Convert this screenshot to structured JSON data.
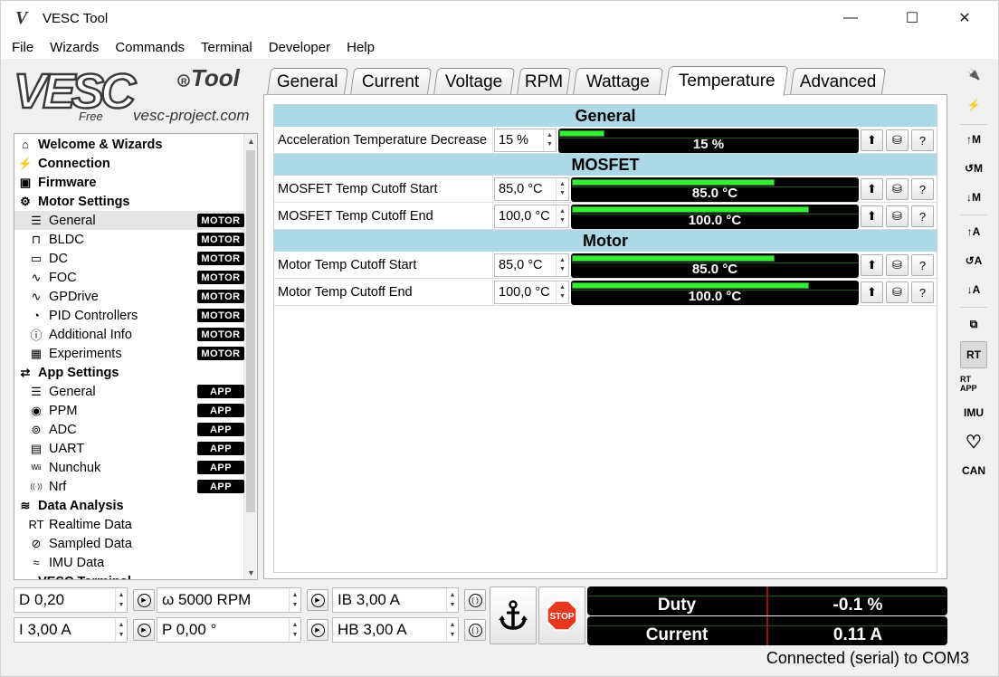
{
  "window": {
    "title": "VESC Tool",
    "minimize": "—",
    "maximize": "☐",
    "close": "✕"
  },
  "menu": [
    "File",
    "Wizards",
    "Commands",
    "Terminal",
    "Developer",
    "Help"
  ],
  "logo": {
    "main": "VESC",
    "tool": "Tool",
    "free": "Free",
    "url": "vesc-project.com"
  },
  "tree": [
    {
      "label": "Welcome & Wizards",
      "level": 0,
      "icon": "home-icon",
      "glyph": "⌂"
    },
    {
      "label": "Connection",
      "level": 0,
      "icon": "plug-icon",
      "glyph": "⚡"
    },
    {
      "label": "Firmware",
      "level": 0,
      "icon": "chip-icon",
      "glyph": "▣"
    },
    {
      "label": "Motor Settings",
      "level": 0,
      "icon": "gear-icon",
      "glyph": "⚙"
    },
    {
      "label": "General",
      "level": 1,
      "icon": "sliders-icon",
      "glyph": "☰",
      "badge": "MOTOR",
      "selected": true
    },
    {
      "label": "BLDC",
      "level": 1,
      "icon": "bldc-icon",
      "glyph": "⊓",
      "badge": "MOTOR"
    },
    {
      "label": "DC",
      "level": 1,
      "icon": "battery-icon",
      "glyph": "▭",
      "badge": "MOTOR"
    },
    {
      "label": "FOC",
      "level": 1,
      "icon": "sine-icon",
      "glyph": "∿",
      "badge": "MOTOR"
    },
    {
      "label": "GPDrive",
      "level": 1,
      "icon": "sine-icon",
      "glyph": "∿",
      "badge": "MOTOR"
    },
    {
      "label": "PID Controllers",
      "level": 1,
      "icon": "gauge-icon",
      "glyph": "◔",
      "badge": "MOTOR"
    },
    {
      "label": "Additional Info",
      "level": 1,
      "icon": "info-icon",
      "glyph": "ⓘ",
      "badge": "MOTOR"
    },
    {
      "label": "Experiments",
      "level": 1,
      "icon": "calculator-icon",
      "glyph": "▦",
      "badge": "MOTOR"
    },
    {
      "label": "App Settings",
      "level": 0,
      "icon": "arrows-icon",
      "glyph": "⇄"
    },
    {
      "label": "General",
      "level": 1,
      "icon": "sliders-icon",
      "glyph": "☰",
      "badge": "APP"
    },
    {
      "label": "PPM",
      "level": 1,
      "icon": "gamepad-icon",
      "glyph": "◉",
      "badge": "APP"
    },
    {
      "label": "ADC",
      "level": 1,
      "icon": "adc-icon",
      "glyph": "⊚",
      "badge": "APP"
    },
    {
      "label": "UART",
      "level": 1,
      "icon": "serial-icon",
      "glyph": "▤",
      "badge": "APP"
    },
    {
      "label": "Nunchuk",
      "level": 1,
      "icon": "wii-icon",
      "glyph": "Wii",
      "badge": "APP"
    },
    {
      "label": "Nrf",
      "level": 1,
      "icon": "radio-icon",
      "glyph": "((·))",
      "badge": "APP"
    },
    {
      "label": "Data Analysis",
      "level": 0,
      "icon": "chart-icon",
      "glyph": "≋"
    },
    {
      "label": "Realtime Data",
      "level": 1,
      "icon": "rt-icon",
      "glyph": "RT"
    },
    {
      "label": "Sampled Data",
      "level": 1,
      "icon": "sampled-icon",
      "glyph": "⊘"
    },
    {
      "label": "IMU Data",
      "level": 1,
      "icon": "imu-icon",
      "glyph": "≈"
    },
    {
      "label": "VESC Terminal",
      "level": 0,
      "icon": "terminal-icon",
      "glyph": "▭"
    }
  ],
  "tabs": [
    "General",
    "Current",
    "Voltage",
    "RPM",
    "Wattage",
    "Temperature",
    "Advanced"
  ],
  "active_tab": "Temperature",
  "sections": [
    {
      "title": "General",
      "rows": [
        {
          "label": "Acceleration Temperature Decrease",
          "value": "15 %",
          "bar_text": "15 %",
          "fraction": 0.15
        }
      ]
    },
    {
      "title": "MOSFET",
      "rows": [
        {
          "label": "MOSFET Temp Cutoff Start",
          "value": "85,0 °C",
          "bar_text": "85.0 °C",
          "fraction": 0.71
        },
        {
          "label": "MOSFET Temp Cutoff End",
          "value": "100,0 °C",
          "bar_text": "100.0 °C",
          "fraction": 0.83
        }
      ]
    },
    {
      "title": "Motor",
      "rows": [
        {
          "label": "Motor Temp Cutoff Start",
          "value": "85,0 °C",
          "bar_text": "85.0 °C",
          "fraction": 0.71
        },
        {
          "label": "Motor Temp Cutoff End",
          "value": "100,0 °C",
          "bar_text": "100.0 °C",
          "fraction": 0.83
        }
      ]
    }
  ],
  "right_toolbar": [
    "connect-icon",
    "disconnect-icon",
    "read-motor-config-icon",
    "read-default-motor-config-icon",
    "write-motor-config-icon",
    "read-app-config-icon",
    "read-default-app-config-icon",
    "write-app-config-icon",
    "can-devices-icon",
    "rt-stream-icon",
    "rt-app-icon",
    "imu-stream-icon",
    "keepalive-heart-icon",
    "can-forward-icon"
  ],
  "right_toolbar_labels": {
    "m_up": "↑M",
    "m_re": "↺M",
    "m_dn": "↓M",
    "a_up": "↑A",
    "a_re": "↺A",
    "a_dn": "↓A",
    "rt": "RT",
    "rtapp": "RT APP",
    "imu": "IMU",
    "can": "CAN"
  },
  "controls": {
    "duty": "D 0,20",
    "rpm": "ω 5000 RPM",
    "brake": "IB 3,00 A",
    "current": "I 3,00 A",
    "position": "P 0,00 °",
    "handbrake": "HB 3,00 A",
    "stop": "STOP"
  },
  "displays": [
    {
      "label": "Duty",
      "value": "-0.1 %"
    },
    {
      "label": "Current",
      "value": "0.11 A"
    }
  ],
  "status": "Connected (serial) to COM3",
  "colors": {
    "section_header": "#add8e6",
    "bar_fill": "#33ee33",
    "stop": "#e8391f"
  }
}
